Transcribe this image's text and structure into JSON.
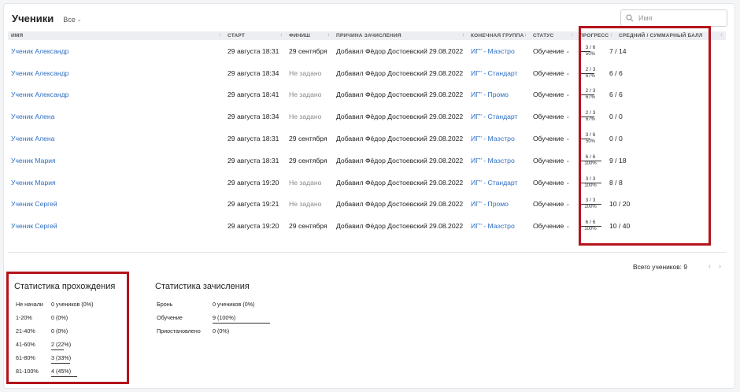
{
  "header": {
    "title": "Ученики",
    "filter_label": "Все"
  },
  "search": {
    "placeholder": "Имя"
  },
  "table": {
    "columns": [
      "ИМЯ",
      "СТАРТ",
      "ФИНИШ",
      "ПРИЧИНА ЗАЧИСЛЕНИЯ",
      "КОНЕЧНАЯ ГРУППА",
      "СТАТУС",
      "ПРОГРЕСС",
      "СРЕДНИЙ / СУММАРНЫЙ БАЛЛ"
    ],
    "rows": [
      {
        "name": "Ученик Александр",
        "start": "29 августа 18:31",
        "finish": "29 сентября",
        "reason": "Добавил Фёдор Достоевский 29.08.2022",
        "group": "ИГ\" - Маэстро",
        "status": "Обучение",
        "progress": "3 / 6",
        "progress_pct": "50%",
        "progress_value": 0.5,
        "score": "7 / 14"
      },
      {
        "name": "Ученик Александр",
        "start": "29 августа 18:34",
        "finish": "Не задано",
        "reason": "Добавил Фёдор Достоевский 29.08.2022",
        "group": "ИГ\" - Стандарт",
        "status": "Обучение",
        "progress": "2 / 3",
        "progress_pct": "67%",
        "progress_value": 0.67,
        "score": "6 / 6"
      },
      {
        "name": "Ученик Александр",
        "start": "29 августа 18:41",
        "finish": "Не задано",
        "reason": "Добавил Фёдор Достоевский 29.08.2022",
        "group": "ИГ\" - Промо",
        "status": "Обучение",
        "progress": "2 / 3",
        "progress_pct": "67%",
        "progress_value": 0.67,
        "score": "6 / 6"
      },
      {
        "name": "Ученик Алена",
        "start": "29 августа 18:34",
        "finish": "Не задано",
        "reason": "Добавил Фёдор Достоевский 29.08.2022",
        "group": "ИГ\" - Стандарт",
        "status": "Обучение",
        "progress": "2 / 3",
        "progress_pct": "67%",
        "progress_value": 0.67,
        "score": "0 / 0"
      },
      {
        "name": "Ученик Алена",
        "start": "29 августа 18:31",
        "finish": "29 сентября",
        "reason": "Добавил Фёдор Достоевский 29.08.2022",
        "group": "ИГ\" - Маэстро",
        "status": "Обучение",
        "progress": "3 / 6",
        "progress_pct": "50%",
        "progress_value": 0.5,
        "score": "0 / 0"
      },
      {
        "name": "Ученик Мария",
        "start": "29 августа 18:31",
        "finish": "29 сентября",
        "reason": "Добавил Фёдор Достоевский 29.08.2022",
        "group": "ИГ\" - Маэстро",
        "status": "Обучение",
        "progress": "6 / 6",
        "progress_pct": "100%",
        "progress_value": 1.0,
        "score": "9 / 18"
      },
      {
        "name": "Ученик Мария",
        "start": "29 августа 19:20",
        "finish": "Не задано",
        "reason": "Добавил Фёдор Достоевский 29.08.2022",
        "group": "ИГ\" - Стандарт",
        "status": "Обучение",
        "progress": "3 / 3",
        "progress_pct": "100%",
        "progress_value": 1.0,
        "score": "8 / 8"
      },
      {
        "name": "Ученик Сергей",
        "start": "29 августа 19:21",
        "finish": "Не задано",
        "reason": "Добавил Фёдор Достоевский 29.08.2022",
        "group": "ИГ\" - Промо",
        "status": "Обучение",
        "progress": "3 / 3",
        "progress_pct": "100%",
        "progress_value": 1.0,
        "score": "10 / 20"
      },
      {
        "name": "Ученик Сергей",
        "start": "29 августа 19:20",
        "finish": "29 сентября",
        "reason": "Добавил Фёдор Достоевский 29.08.2022",
        "group": "ИГ\" - Маэстро",
        "status": "Обучение",
        "progress": "6 / 6",
        "progress_pct": "100%",
        "progress_value": 1.0,
        "score": "10 / 40"
      }
    ]
  },
  "footer": {
    "total": "Всего учеников: 9"
  },
  "stats_completion": {
    "title": "Статистика прохождения",
    "rows": [
      {
        "label": "Не начали",
        "value": "0 учеников (0%)",
        "share": 0
      },
      {
        "label": "1-20%",
        "value": "0 (0%)",
        "share": 0
      },
      {
        "label": "21-40%",
        "value": "0 (0%)",
        "share": 0
      },
      {
        "label": "41-60%",
        "value": "2 (22%)",
        "share": 0.22
      },
      {
        "label": "61-80%",
        "value": "3 (33%)",
        "share": 0.33
      },
      {
        "label": "81-100%",
        "value": "4 (45%)",
        "share": 0.45
      }
    ]
  },
  "stats_enrollment": {
    "title": "Статистика зачисления",
    "rows": [
      {
        "label": "Бронь",
        "value": "0 учеников (0%)",
        "share": 0
      },
      {
        "label": "Обучение",
        "value": "9 (100%)",
        "share": 1.0
      },
      {
        "label": "Приостановлено",
        "value": "0 (0%)",
        "share": 0
      }
    ]
  },
  "colors": {
    "link": "#2d6ec2",
    "highlight": "#b4131b",
    "header_bg": "#eceef1"
  },
  "icons": {
    "search": "search-icon",
    "filter_chevron": "chevron-down-icon",
    "sort": "sort-icon",
    "prev": "chevron-left-icon",
    "next": "chevron-right-icon"
  }
}
